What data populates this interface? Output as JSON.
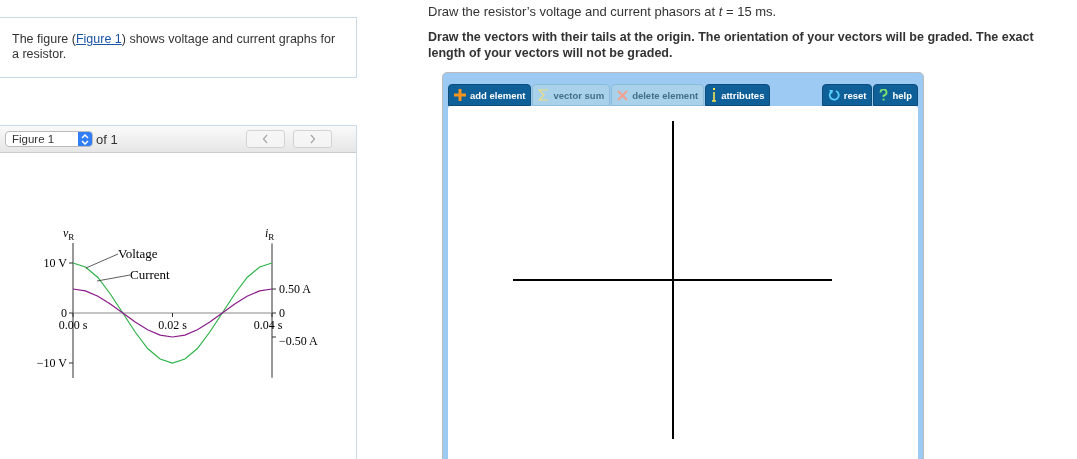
{
  "intro": {
    "before": "The figure (",
    "link": "Figure 1",
    "after": ") shows voltage and current graphs for a resistor."
  },
  "figure_viewer": {
    "select_value": "Figure 1",
    "of_text": "of 1",
    "prev_disabled": true,
    "next_disabled": true
  },
  "figure": {
    "left_axis_label": {
      "symbol": "v",
      "subscript": "R"
    },
    "right_axis_label": {
      "symbol": "i",
      "subscript": "R"
    },
    "chart_data": {
      "type": "line",
      "xlim": [
        0,
        0.04
      ],
      "ylim": [
        -13,
        14
      ],
      "x": [
        0,
        0.0025,
        0.005,
        0.0075,
        0.01,
        0.0125,
        0.015,
        0.0175,
        0.02,
        0.0225,
        0.025,
        0.0275,
        0.03,
        0.0325,
        0.035,
        0.0375,
        0.04
      ],
      "xticks": [
        {
          "value": 0,
          "label": "0.00 s"
        },
        {
          "value": 0.02,
          "label": "0.02 s"
        },
        {
          "value": 0.04,
          "label": "0.04 s"
        }
      ],
      "yticks": [
        {
          "value": 10,
          "label": "10 V"
        },
        {
          "value": 0,
          "label": "0"
        },
        {
          "value": -10,
          "label": "−10 V"
        }
      ],
      "y2lim": [
        -1.35,
        1.45
      ],
      "y2ticks": [
        {
          "value": 0.5,
          "label": "0.50 A"
        },
        {
          "value": 0,
          "label": "0"
        },
        {
          "value": -0.5,
          "label": "−0.50 A"
        }
      ],
      "series": [
        {
          "name": "Voltage",
          "color": "#2eb34a",
          "values": [
            10,
            9.2,
            7.1,
            3.8,
            0,
            -3.8,
            -7.1,
            -9.2,
            -10,
            -9.2,
            -7.1,
            -3.8,
            0,
            3.8,
            7.1,
            9.2,
            10
          ]
        },
        {
          "name": "Current",
          "color": "#8b1a8b",
          "axis": "y2",
          "values": [
            0.5,
            0.46,
            0.35,
            0.19,
            0,
            -0.19,
            -0.35,
            -0.46,
            -0.5,
            -0.46,
            -0.35,
            -0.19,
            0,
            0.19,
            0.35,
            0.46,
            0.5
          ]
        }
      ]
    }
  },
  "question": "Draw the resistor’s voltage and current phasors at *t* = 15 ms.",
  "instructions": "Draw the vectors with their tails at the origin. The orientation of your vectors will be graded. The exact length of your vectors will not be graded.",
  "toolbar": [
    {
      "kind": "add",
      "label": "add element",
      "disabled": false
    },
    {
      "kind": "sum",
      "label": "vector sum",
      "disabled": true
    },
    {
      "kind": "delete",
      "label": "delete element",
      "disabled": true
    },
    {
      "kind": "info",
      "label": "attributes",
      "disabled": false
    }
  ],
  "toolbar_right": [
    {
      "kind": "reset",
      "label": "reset",
      "disabled": false
    },
    {
      "kind": "help",
      "label": "help",
      "disabled": false
    }
  ]
}
